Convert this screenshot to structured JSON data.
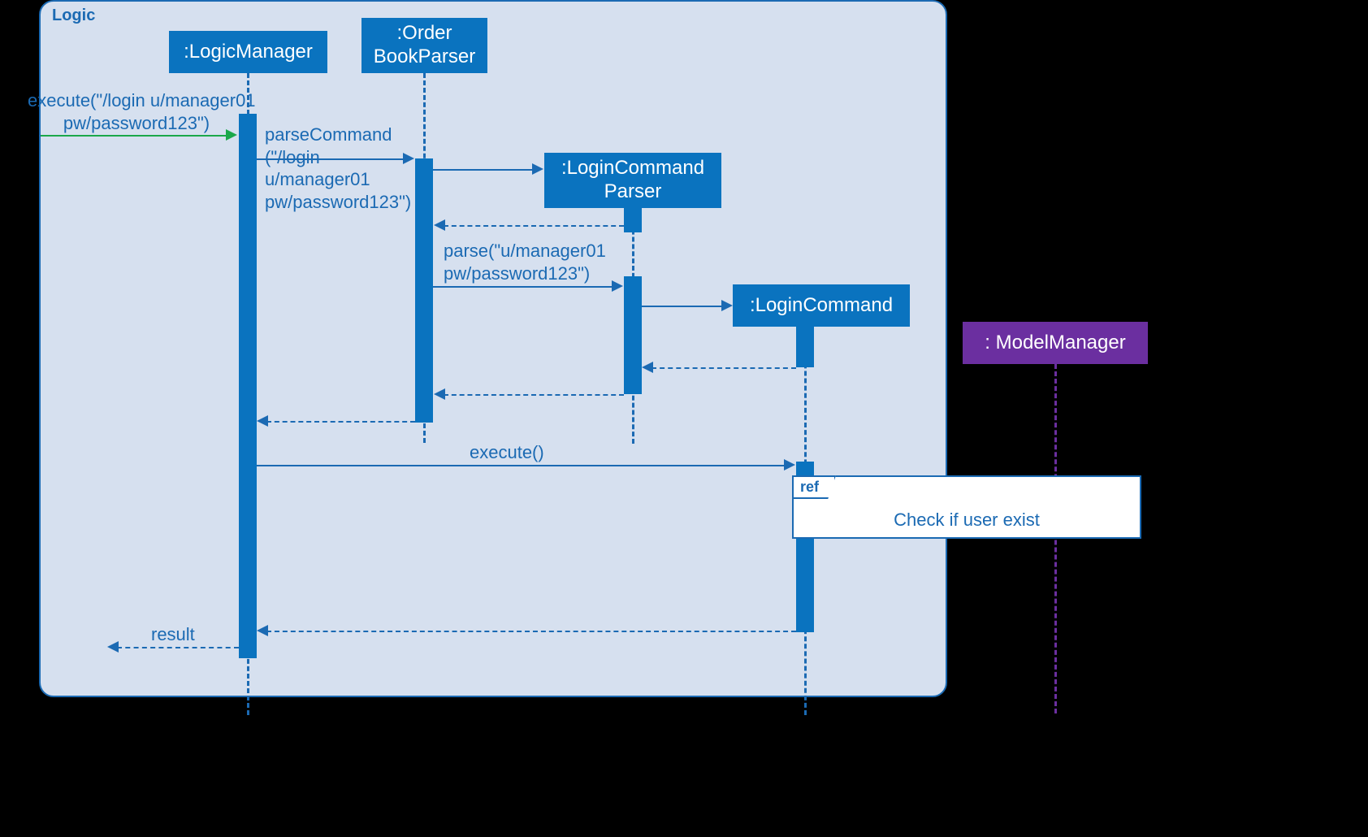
{
  "frame": {
    "label": "Logic"
  },
  "lifelines": {
    "logicManager": ":LogicManager",
    "orderBookParser": ":Order\nBookParser",
    "loginCommandParser": ":LoginCommand\nParser",
    "loginCommand": ":LoginCommand",
    "modelManager": ": ModelManager"
  },
  "messages": {
    "executeIn": "execute(\"/login u/manager01\npw/password123\")",
    "parseCommand": "parseCommand\n(\"/login\nu/manager01\npw/password123\")",
    "parse": "parse(\"u/manager01\npw/password123\")",
    "executeCall": "execute()",
    "result": "result"
  },
  "ref": {
    "tab": "ref",
    "text": "Check if user exist"
  },
  "colors": {
    "blue": "#0a73bf",
    "lineBlue": "#1b6ab3",
    "frameBg": "#d6e0ef",
    "green": "#1ba84a",
    "purple": "#6b2fa0"
  }
}
